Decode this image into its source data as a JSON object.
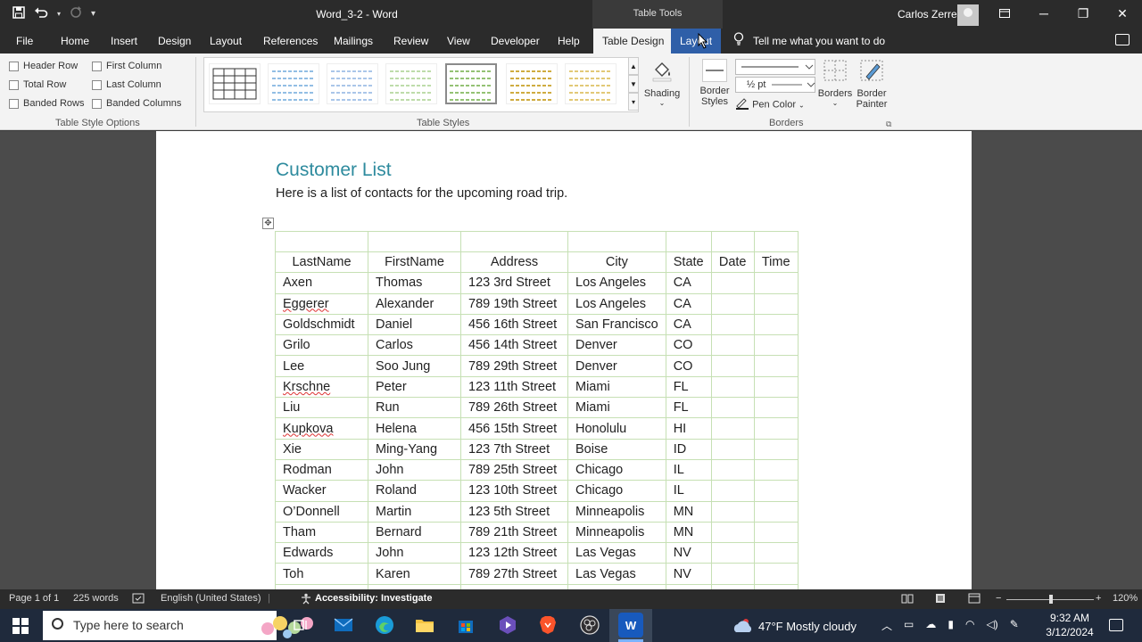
{
  "titlebar": {
    "doc_title": "Word_3-2  -  Word",
    "table_tools": "Table Tools",
    "user": "Carlos Zerre",
    "qat": {
      "save_icon": "save-icon",
      "undo_icon": "undo-icon",
      "redo_icon": "redo-icon",
      "customize": "▾"
    }
  },
  "tabs": [
    "File",
    "Home",
    "Insert",
    "Design",
    "Layout",
    "References",
    "Mailings",
    "Review",
    "View",
    "Developer",
    "Help",
    "Table Design",
    "Layout"
  ],
  "tellme": "Tell me what you want to do",
  "ribbon": {
    "style_options": {
      "header_row": "Header Row",
      "total_row": "Total Row",
      "banded_rows": "Banded Rows",
      "first_column": "First Column",
      "last_column": "Last Column",
      "banded_columns": "Banded Columns",
      "group_label": "Table Style Options"
    },
    "table_styles": {
      "group_label": "Table Styles"
    },
    "shading": "Shading",
    "border_styles_1": "Border",
    "border_styles_2": "Styles",
    "pen_weight": "½ pt",
    "pen_color": "Pen Color",
    "borders": "Borders",
    "border_painter_1": "Border",
    "border_painter_2": "Painter",
    "borders_group": "Borders"
  },
  "document": {
    "heading": "Customer List",
    "intro": "Here is a list of contacts for the upcoming road trip.",
    "table": {
      "headers": [
        "LastName",
        "FirstName",
        "Address",
        "City",
        "State",
        "Date",
        "Time"
      ],
      "rows": [
        [
          "Axen",
          "Thomas",
          "123 3rd Street",
          "Los Angeles",
          "CA"
        ],
        [
          "Eggerer",
          "Alexander",
          "789 19th Street",
          "Los Angeles",
          "CA"
        ],
        [
          "Goldschmidt",
          "Daniel",
          "456 16th Street",
          "San Francisco",
          "CA"
        ],
        [
          "Grilo",
          "Carlos",
          "456 14th Street",
          "Denver",
          "CO"
        ],
        [
          "Lee",
          "Soo Jung",
          "789 29th Street",
          "Denver",
          "CO"
        ],
        [
          "Krschne",
          "Peter",
          "123 11th Street",
          "Miami",
          "FL"
        ],
        [
          "Liu",
          "Run",
          "789 26th Street",
          "Miami",
          "FL"
        ],
        [
          "Kupkova",
          "Helena",
          "456 15th Street",
          "Honolulu",
          "HI"
        ],
        [
          "Xie",
          "Ming-Yang",
          "123 7th Street",
          "Boise",
          "ID"
        ],
        [
          "Rodman",
          "John",
          "789 25th Street",
          "Chicago",
          "IL"
        ],
        [
          "Wacker",
          "Roland",
          "123 10th Street",
          "Chicago",
          "IL"
        ],
        [
          "O’Donnell",
          "Martin",
          "123 5th Street",
          "Minneapolis",
          "MN"
        ],
        [
          "Tham",
          "Bernard",
          "789 21th Street",
          "Minneapolis",
          "MN"
        ],
        [
          "Edwards",
          "John",
          "123 12th Street",
          "Las Vegas",
          "NV"
        ],
        [
          "Toh",
          "Karen",
          "789 27th Street",
          "Las Vegas",
          "NV"
        ]
      ]
    }
  },
  "status": {
    "page": "Page 1 of 1",
    "words": "225 words",
    "language": "English (United States)",
    "accessibility": "Accessibility: Investigate",
    "zoom": "120%"
  },
  "taskbar": {
    "search_placeholder": "Type here to search",
    "weather": "47°F  Mostly cloudy",
    "time": "9:32 AM",
    "date": "3/12/2024"
  },
  "colors": {
    "accent_blue": "#2f5fa8",
    "heading_teal": "#2e8b9e",
    "table_border": "#c6e0b4"
  }
}
